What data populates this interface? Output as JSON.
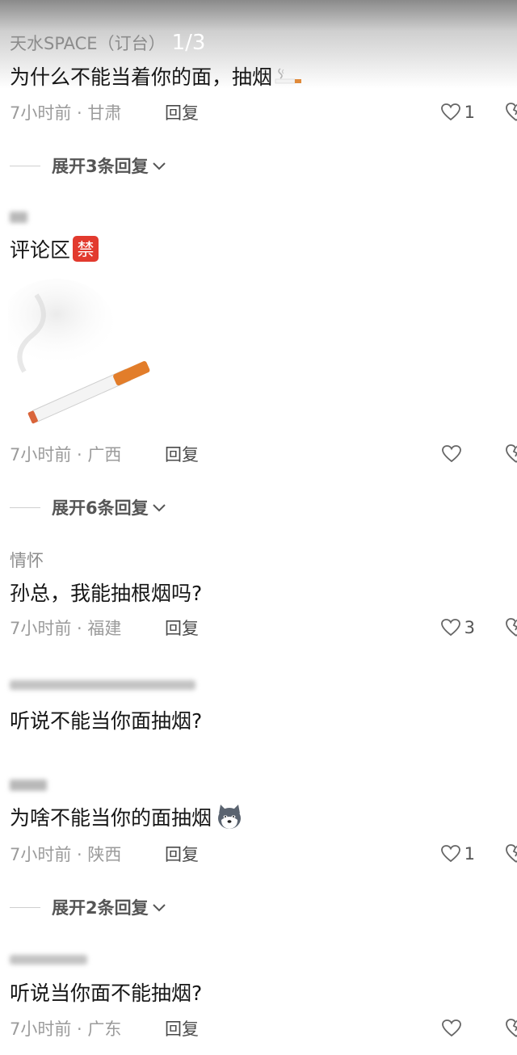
{
  "comments": [
    {
      "username": "天水SPACE（订台）",
      "page_indicator": "1/3",
      "text": "为什么不能当着你的面，抽烟",
      "time_location": "7小时前 · 甘肃",
      "reply_label": "回复",
      "likes": "1",
      "expand_label": "展开3条回复"
    },
    {
      "text": "评论区",
      "badge": "禁",
      "time_location": "7小时前 · 广西",
      "reply_label": "回复",
      "expand_label": "展开6条回复"
    },
    {
      "username": "情怀",
      "text": "孙总，我能抽根烟吗?",
      "time_location": "7小时前 · 福建",
      "reply_label": "回复",
      "likes": "3"
    },
    {
      "text": "听说不能当你面抽烟?"
    },
    {
      "text": "为啥不能当你的面抽烟",
      "time_location": "7小时前 · 陕西",
      "reply_label": "回复",
      "likes": "1",
      "expand_label": "展开2条回复"
    },
    {
      "text": "听说当你面不能抽烟?",
      "time_location": "7小时前 · 广东",
      "reply_label": "回复"
    }
  ],
  "icons": {
    "like": "heart-outline-icon",
    "dislike": "broken-heart-icon",
    "expand": "chevron-down-icon",
    "cigarette_emoji": "cigarette-emoji",
    "husky_emoji": "husky-dog-emoji"
  },
  "colors": {
    "accent_badge": "#e23a2e",
    "meta_text": "#9b9b9b",
    "body_text": "#161616"
  }
}
